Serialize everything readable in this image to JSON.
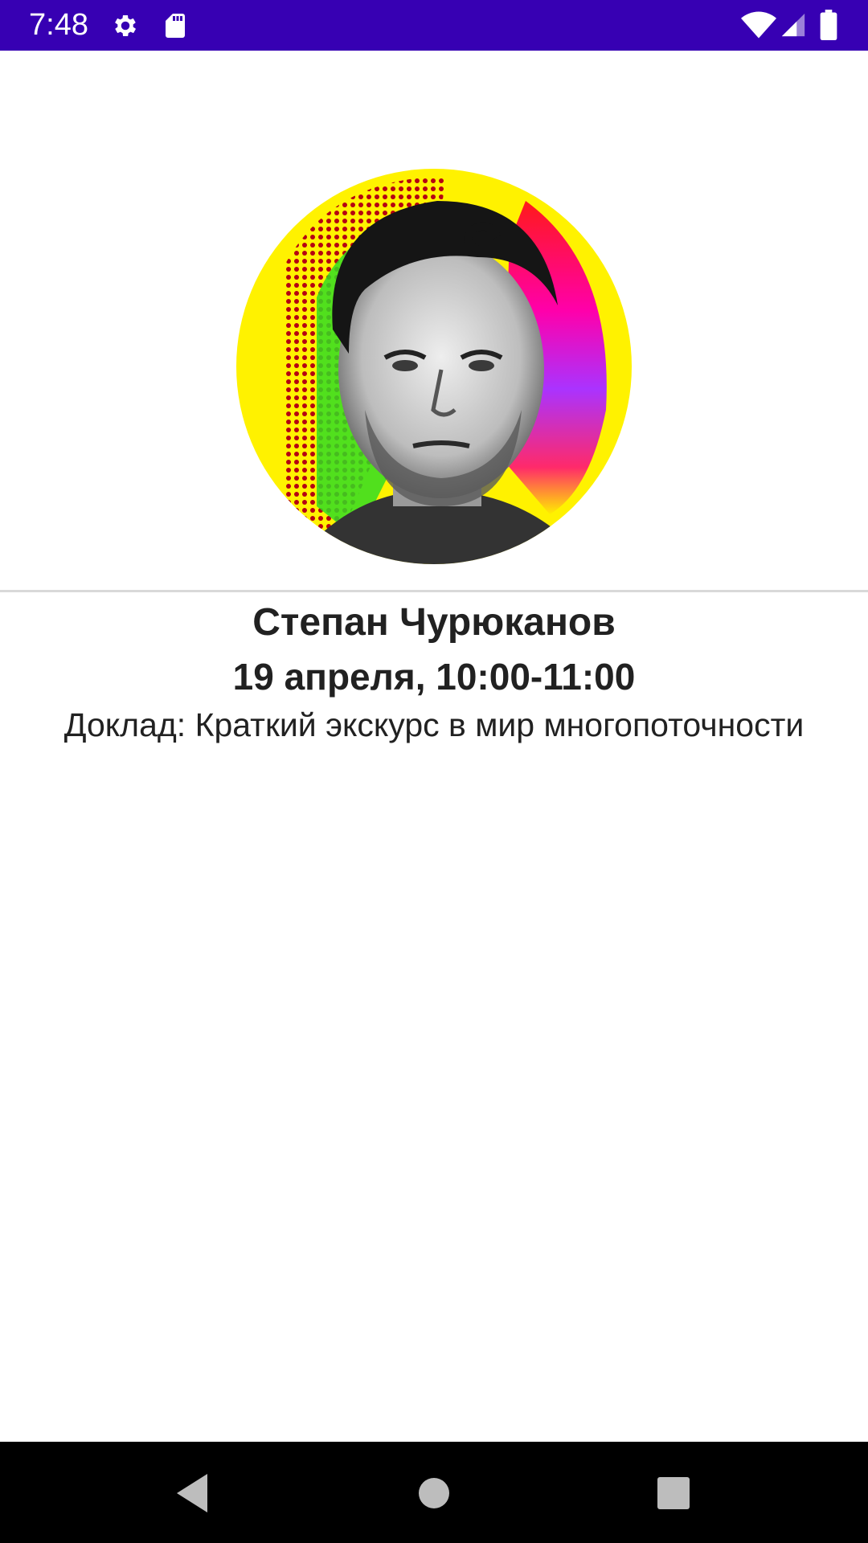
{
  "status_bar": {
    "time": "7:48",
    "background_color": "#3700b3",
    "icons": [
      "gear-icon",
      "sd-card-icon",
      "wifi-icon",
      "signal-icon",
      "battery-icon"
    ]
  },
  "speaker": {
    "avatar_icon": "speaker-photo",
    "name": "Степан Чурюканов",
    "datetime": "19 апреля, 10:00-11:00",
    "talk": "Доклад: Краткий экскурс в мир многопоточности"
  },
  "nav_bar": {
    "background_color": "#000000",
    "icons": [
      "back-icon",
      "home-icon",
      "recents-icon"
    ]
  }
}
